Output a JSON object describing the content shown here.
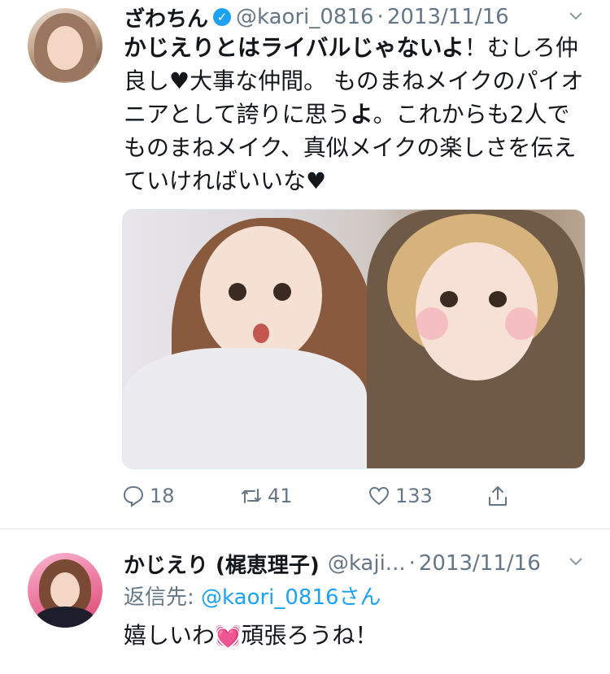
{
  "tweet1": {
    "name": "ざわちん",
    "handle": "@kaori_0816",
    "dot": "·",
    "date": "2013/11/16",
    "text_bold": "かじえりとはライバルじゃないよ",
    "text_rest1": "！むしろ仲良し",
    "heart": "♥",
    "text_rest2": "大事な仲間。 ものまねメイクのパイオニアとして誇りに思う",
    "text_bold2": "よ",
    "text_rest3": "。これからも2人でものまねメイク、真似メイクの楽しさを伝えていければいいな",
    "heart2": "♥",
    "actions": {
      "reply_count": "18",
      "retweet_count": "41",
      "like_count": "133"
    }
  },
  "tweet2": {
    "name": "かじえり (梶恵理子)",
    "handle": "@kaji...",
    "dot": "·",
    "date": "2013/11/16",
    "reply_prefix": "返信先: ",
    "reply_handle": "@kaori_0816さん",
    "text_before": "嬉しいわ",
    "emoji": "💓",
    "text_after": "頑張ろうね！"
  }
}
